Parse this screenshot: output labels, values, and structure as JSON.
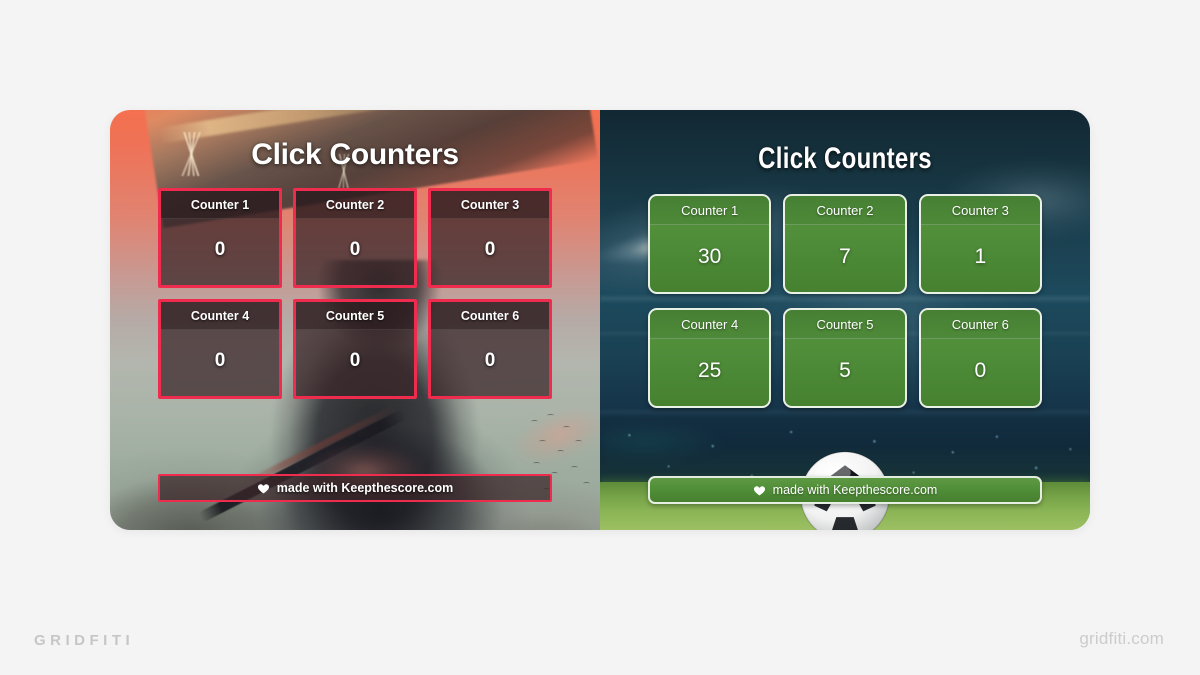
{
  "page": {
    "background_color": "#f4f4f4",
    "brand_left": "GRIDFITI",
    "brand_right": "gridfiti.com"
  },
  "panels": [
    {
      "id": "samurai-theme",
      "theme_name": "samurai",
      "title": "Click Counters",
      "accent_color": "#ef2b4e",
      "card_background": "#3a2628",
      "counters": [
        {
          "label": "Counter 1",
          "value": "0"
        },
        {
          "label": "Counter 2",
          "value": "0"
        },
        {
          "label": "Counter 3",
          "value": "0"
        },
        {
          "label": "Counter 4",
          "value": "0"
        },
        {
          "label": "Counter 5",
          "value": "0"
        },
        {
          "label": "Counter 6",
          "value": "0"
        }
      ],
      "credit": {
        "icon": "heart-icon",
        "text": "made with Keepthescore.com"
      }
    },
    {
      "id": "stadium-theme",
      "theme_name": "soccer-stadium",
      "title": "Click Counters",
      "accent_color": "#4d8b38",
      "card_background": "#4d8b38",
      "counters": [
        {
          "label": "Counter 1",
          "value": "30"
        },
        {
          "label": "Counter 2",
          "value": "7"
        },
        {
          "label": "Counter 3",
          "value": "1"
        },
        {
          "label": "Counter 4",
          "value": "25"
        },
        {
          "label": "Counter 5",
          "value": "5"
        },
        {
          "label": "Counter 6",
          "value": "0"
        }
      ],
      "credit": {
        "icon": "heart-icon",
        "text": "made with Keepthescore.com"
      }
    }
  ]
}
